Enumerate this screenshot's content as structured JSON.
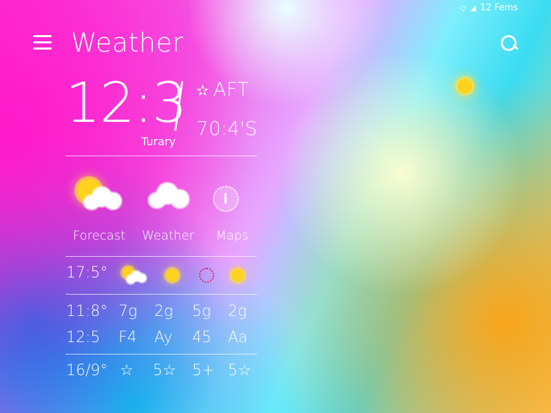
{
  "status": {
    "battery_icon": "shield-icon",
    "signal_icon": "signal-icon",
    "text": "12 Fems"
  },
  "header": {
    "menu_icon": "menu-icon",
    "title": "Weather",
    "search_icon": "search-icon"
  },
  "clock": {
    "time": "12:3",
    "date": "Turary",
    "period_star": "✫",
    "period": "AFT",
    "temperature": "70:4'S"
  },
  "nav": [
    {
      "label": "Forecast",
      "icon": "sun-cloud-icon"
    },
    {
      "label": "Weather",
      "icon": "cloud-icon"
    },
    {
      "label": "Maps",
      "icon": "compass-icon"
    }
  ],
  "rows": [
    {
      "label": "17:5°",
      "icons": [
        "sun-cloud-icon",
        "sun-icon",
        "red-sun-icon",
        "sun-icon"
      ]
    },
    {
      "label": "11:8°",
      "values": [
        "7g",
        "2g",
        "5g",
        "2g"
      ]
    },
    {
      "label": "12:5",
      "values": [
        "F4",
        "Ay",
        "45",
        "Aa"
      ]
    },
    {
      "label": "16/9°",
      "values": [
        "☆",
        "5☆",
        "5+",
        "5☆"
      ]
    }
  ],
  "colors": {
    "sun": "#ffd21e",
    "text": "#ffffff"
  }
}
